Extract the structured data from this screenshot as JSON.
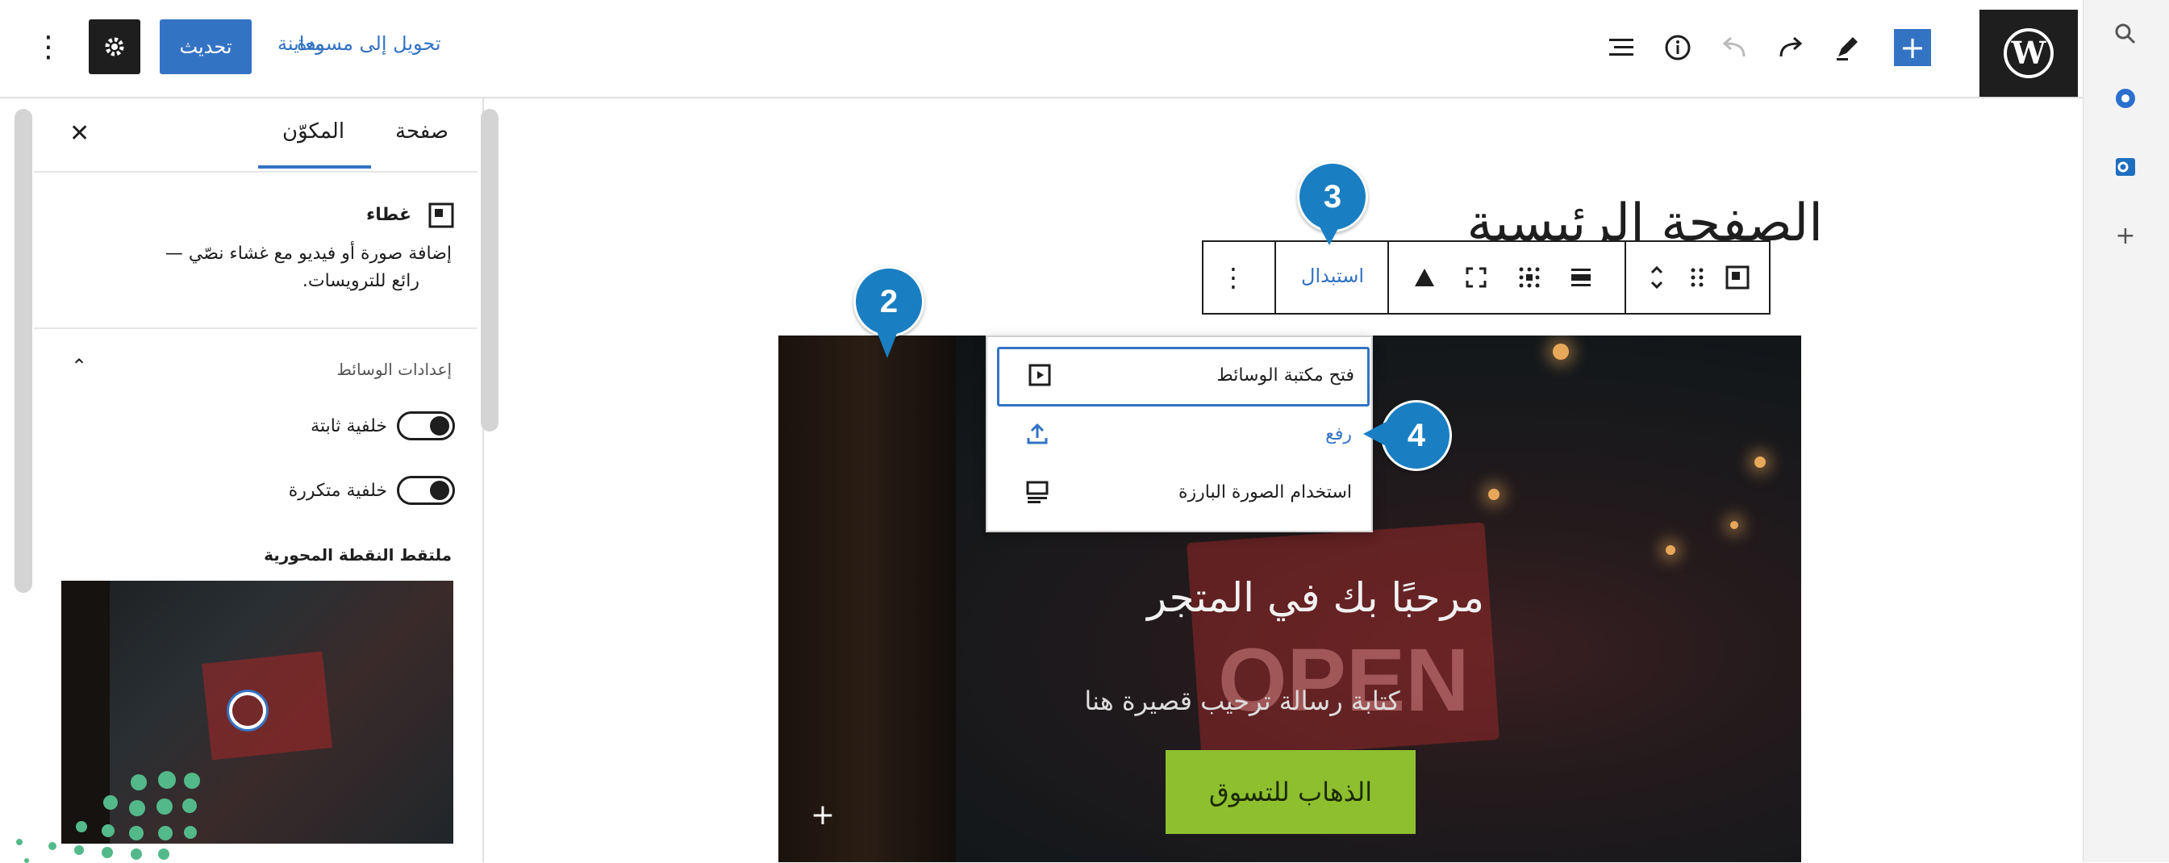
{
  "topbar": {
    "update_label": "تحديث",
    "preview_label": "معاينة",
    "switch_to_draft_label": "تحويل إلى مسودة",
    "settings_icon": "gear-icon",
    "more_icon": "vertical-dots-icon",
    "add_block_icon": "plus-icon",
    "edit_icon": "pencil-icon",
    "redo_icon": "redo-icon",
    "undo_icon": "undo-icon",
    "info_icon": "info-icon",
    "list_view_icon": "list-view-icon",
    "logo_icon": "wordpress-logo-icon"
  },
  "sidebar": {
    "tabs": [
      {
        "label": "صفحة",
        "active": false
      },
      {
        "label": "المكوّن",
        "active": true
      }
    ],
    "close_icon": "close-icon",
    "block": {
      "name": "غطاء",
      "description_line1": "إضافة صورة أو فيديو مع غشاء نصّي —",
      "description_line2": "رائع للترويسات."
    },
    "media_settings": {
      "title": "إعدادات الوسائط",
      "fixed_background_label": "خلفية ثابتة",
      "repeated_background_label": "خلفية متكررة",
      "focal_point_label": "ملتقط النقطة المحورية"
    }
  },
  "canvas": {
    "page_title": "الصفحة الرئيسية",
    "cover_heading": "مرحبًا بك في المتجر",
    "cover_subtext": "كتابة رسالة ترحيب قصيرة هنا",
    "shop_button_label": "الذهاب للتسوق",
    "open_sign_text": "OPEN"
  },
  "block_toolbar": {
    "replace_label": "استبدال"
  },
  "replace_menu": {
    "items": [
      {
        "label": "فتح مكتبة الوسائط",
        "icon": "media-library-icon"
      },
      {
        "label": "رفع",
        "icon": "upload-icon"
      },
      {
        "label": "استخدام الصورة البارزة",
        "icon": "featured-image-icon"
      }
    ]
  },
  "callouts": [
    "2",
    "3",
    "4"
  ],
  "colors": {
    "accent": "#3373c4",
    "callout": "#1a7fc2",
    "shop_button": "#8dbf2f",
    "dark": "#1e1e1e"
  }
}
